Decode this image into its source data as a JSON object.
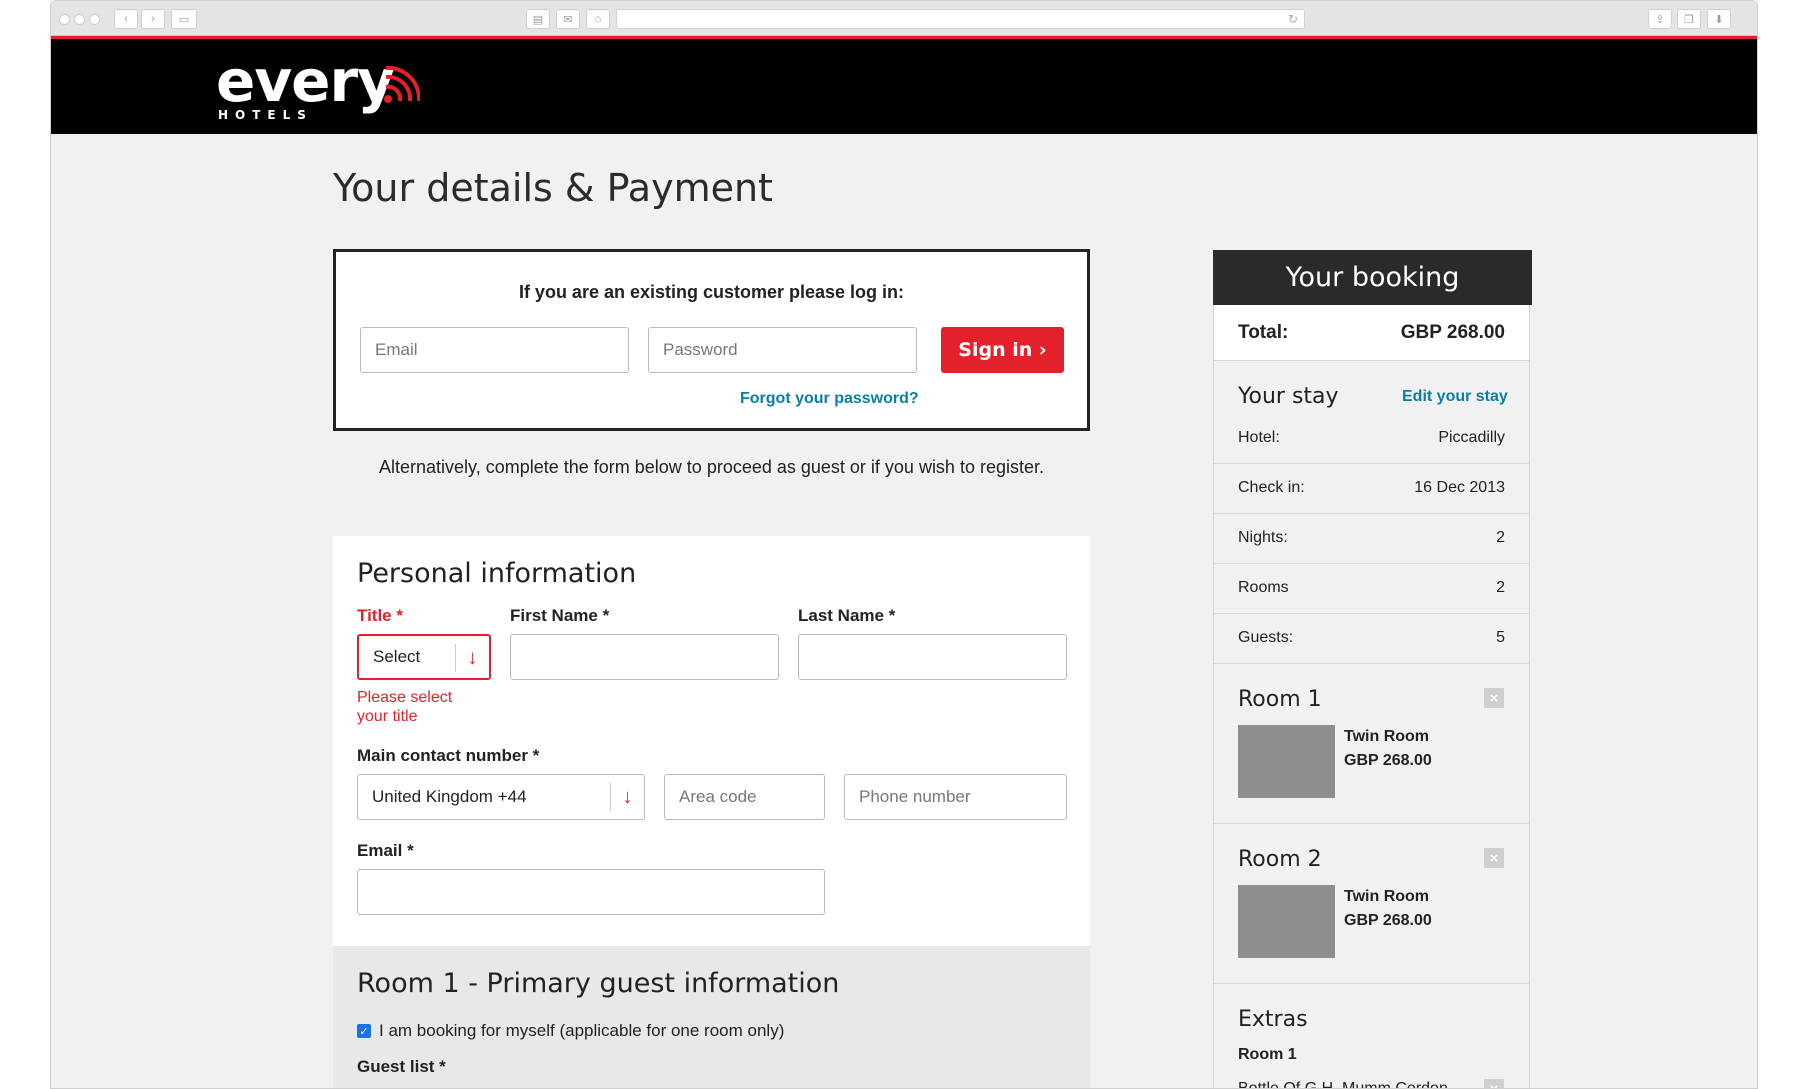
{
  "brand": {
    "logo_word": "every",
    "logo_sub": "HOTELS"
  },
  "page": {
    "title": "Your details & Payment"
  },
  "login": {
    "heading": "If you are an existing customer please log in:",
    "email_placeholder": "Email",
    "password_placeholder": "Password",
    "sign_in_label": "Sign in ›",
    "forgot_label": "Forgot your password?"
  },
  "alt_text": "Alternatively, complete the form below to proceed as guest or if you wish to register.",
  "personal": {
    "section_title": "Personal information",
    "title_label": "Title *",
    "title_value": "Select",
    "title_error": "Please select your title",
    "first_name_label": "First Name *",
    "last_name_label": "Last Name *",
    "contact_label": "Main contact number *",
    "country_value": "United Kingdom +44",
    "area_code_placeholder": "Area code",
    "phone_placeholder": "Phone number",
    "email_label": "Email *"
  },
  "room_guest": {
    "section_title": "Room 1 - Primary guest information",
    "booking_self_label": "I am booking for myself (applicable for one room only)",
    "booking_self_checked": true,
    "guest_list_label": "Guest list *"
  },
  "booking": {
    "heading": "Your booking",
    "total_label": "Total:",
    "total_value": "GBP 268.00",
    "stay_title": "Your stay",
    "edit_stay_label": "Edit your stay",
    "rows": [
      {
        "label": "Hotel:",
        "value": "Piccadilly"
      },
      {
        "label": "Check in:",
        "value": "16 Dec 2013"
      },
      {
        "label": "Nights:",
        "value": "2"
      },
      {
        "label": "Rooms",
        "value": "2"
      },
      {
        "label": "Guests:",
        "value": "5"
      }
    ],
    "rooms": [
      {
        "title": "Room 1",
        "type": "Twin Room",
        "price": "GBP 268.00"
      },
      {
        "title": "Room 2",
        "type": "Twin Room",
        "price": "GBP 268.00"
      }
    ],
    "extras_title": "Extras",
    "extras_room": "Room 1",
    "extras_item": "Bottle Of G.H. Mumm Cordon"
  },
  "colors": {
    "accent": "#e4202a",
    "link": "#0b7ea8",
    "header_bg": "#000000"
  }
}
